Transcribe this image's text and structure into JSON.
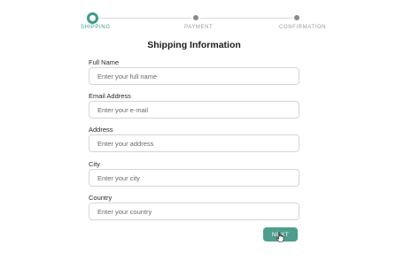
{
  "stepper": {
    "steps": [
      {
        "label": "SHIPPING",
        "state": "active"
      },
      {
        "label": "PAYMENT",
        "state": "inactive"
      },
      {
        "label": "CONFIRMATION",
        "state": "inactive"
      }
    ],
    "accent_color": "#3f9b8a"
  },
  "form": {
    "title": "Shipping Information",
    "fields": [
      {
        "label": "Full Name",
        "value": "",
        "placeholder": "Enter your full name"
      },
      {
        "label": "Email Address",
        "value": "",
        "placeholder": "Enter your e-mail"
      },
      {
        "label": "Address",
        "value": "",
        "placeholder": "Enter your address"
      },
      {
        "label": "City",
        "value": "",
        "placeholder": "Enter your city"
      },
      {
        "label": "Country",
        "value": "",
        "placeholder": "Enter your country"
      }
    ],
    "next_label": "NEXT",
    "button_color": "#4f9d8d"
  },
  "cursor": {
    "icon": "hand-pointer-icon"
  }
}
